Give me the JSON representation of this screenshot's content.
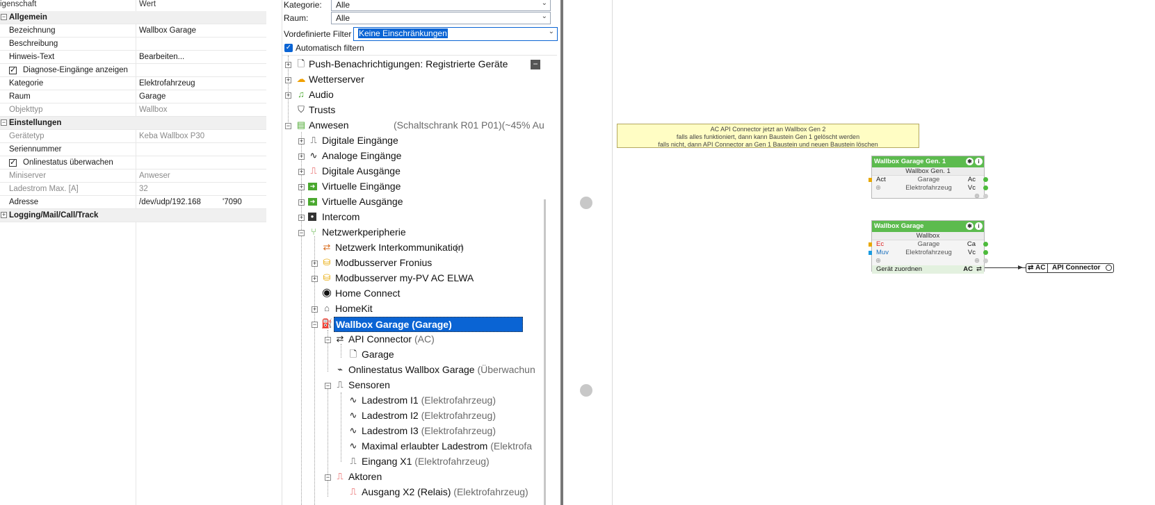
{
  "properties": {
    "col_name": "igenschaft",
    "col_value": "Wert",
    "sections": [
      {
        "label": "Allgemein"
      },
      {
        "label": "Einstellungen"
      },
      {
        "label": "Logging/Mail/Call/Track"
      }
    ],
    "rows": {
      "bezeichnung": {
        "name": "Bezeichnung",
        "value": "Wallbox Garage"
      },
      "beschreibung": {
        "name": "Beschreibung",
        "value": ""
      },
      "hinweis": {
        "name": "Hinweis-Text",
        "value": "Bearbeiten..."
      },
      "diagnose": {
        "name": "Diagnose-Eingänge anzeigen",
        "checked": true
      },
      "kategorie": {
        "name": "Kategorie",
        "value": "Elektrofahrzeug"
      },
      "raum": {
        "name": "Raum",
        "value": "Garage"
      },
      "objekttyp": {
        "name": "Objekttyp",
        "value": "Wallbox"
      },
      "geraetetyp": {
        "name": "Gerätetyp",
        "value": "Keba Wallbox P30"
      },
      "seriennummer": {
        "name": "Seriennummer",
        "value": ""
      },
      "onlinestatus": {
        "name": "Onlinestatus überwachen",
        "checked": true
      },
      "miniserver": {
        "name": "Miniserver",
        "value": "Anweser"
      },
      "ladestrom": {
        "name": "Ladestrom Max. [A]",
        "value": "32"
      },
      "adresse": {
        "name": "Adresse",
        "value": "/dev/udp/192.168",
        "value2": "'7090"
      }
    }
  },
  "filters": {
    "kategorie_label": "Kategorie:",
    "kategorie_value": "Alle",
    "raum_label": "Raum:",
    "raum_value": "Alle",
    "vordefiniert_label": "Vordefinierte Filter",
    "vordefiniert_value": "Keine Einschränkungen",
    "auto_label": "Automatisch filtern",
    "auto_checked": true
  },
  "tree": {
    "push": "Push-Benachrichtigungen: Registrierte Geräte",
    "wetter": "Wetterserver",
    "audio": "Audio",
    "trusts": "Trusts",
    "anwesen": "Anwesen",
    "anwesen_sub": "(Schaltschrank R01 P01)(~45% Au",
    "digein": "Digitale Eingänge",
    "anaein": "Analoge Eingänge",
    "digaus": "Digitale Ausgänge",
    "virtein": "Virtuelle Eingänge",
    "virtaus": "Virtuelle Ausgänge",
    "intercom": "Intercom",
    "netz": "Netzwerkperipherie",
    "netzinter": "Netzwerk Interkommunikation",
    "netzinter_sub": "(                )",
    "modfronius": "Modbusserver Fronius",
    "modmypv": "Modbusserver my-PV AC ELWA",
    "homeconnect": "Home Connect",
    "homekit": "HomeKit",
    "wallbox": "Wallbox Garage (Garage)",
    "api": "API Connector",
    "api_sub": "(AC)",
    "garage": "Garage",
    "online": "Onlinestatus Wallbox Garage",
    "online_sub": "(Überwachun",
    "sensoren": "Sensoren",
    "l1": "Ladestrom I1",
    "l2": "Ladestrom I2",
    "l3": "Ladestrom I3",
    "lmax": "Maximal erlaubter Ladestrom",
    "lmax_sub": "(Elektrofa",
    "x1": "Eingang X1",
    "ef_sub": "(Elektrofahrzeug)",
    "aktoren": "Aktoren",
    "x2": "Ausgang X2 (Relais)",
    "x2_sub": "(Elektrofahrzeug)"
  },
  "canvas": {
    "note_line1": "AC API Connector jetzt an Wallbox Gen 2",
    "note_line2": "falls alles funktioniert, dann kann Baustein Gen 1 gelöscht werden",
    "note_line3": "falls nicht, dann API Connector an Gen 1 Baustein und neuen Baustein löschen",
    "gen1": {
      "title": "Wallbox Garage Gen. 1",
      "sub": "Wallbox Gen. 1",
      "in1": "Act",
      "room": "Garage",
      "cat": "Elektrofahrzeug",
      "out1": "Ac",
      "out2": "Vc"
    },
    "wb": {
      "title": "Wallbox Garage",
      "sub": "Wallbox",
      "in1": "Ec",
      "in2": "Muv",
      "room": "Garage",
      "cat": "Elektrofahrzeug",
      "out1": "Ca",
      "out2": "Vc",
      "assign": "Gerät zuordnen",
      "assign_out": "AC"
    },
    "api_block": {
      "prefix": "AC",
      "label": "API Connector"
    }
  }
}
